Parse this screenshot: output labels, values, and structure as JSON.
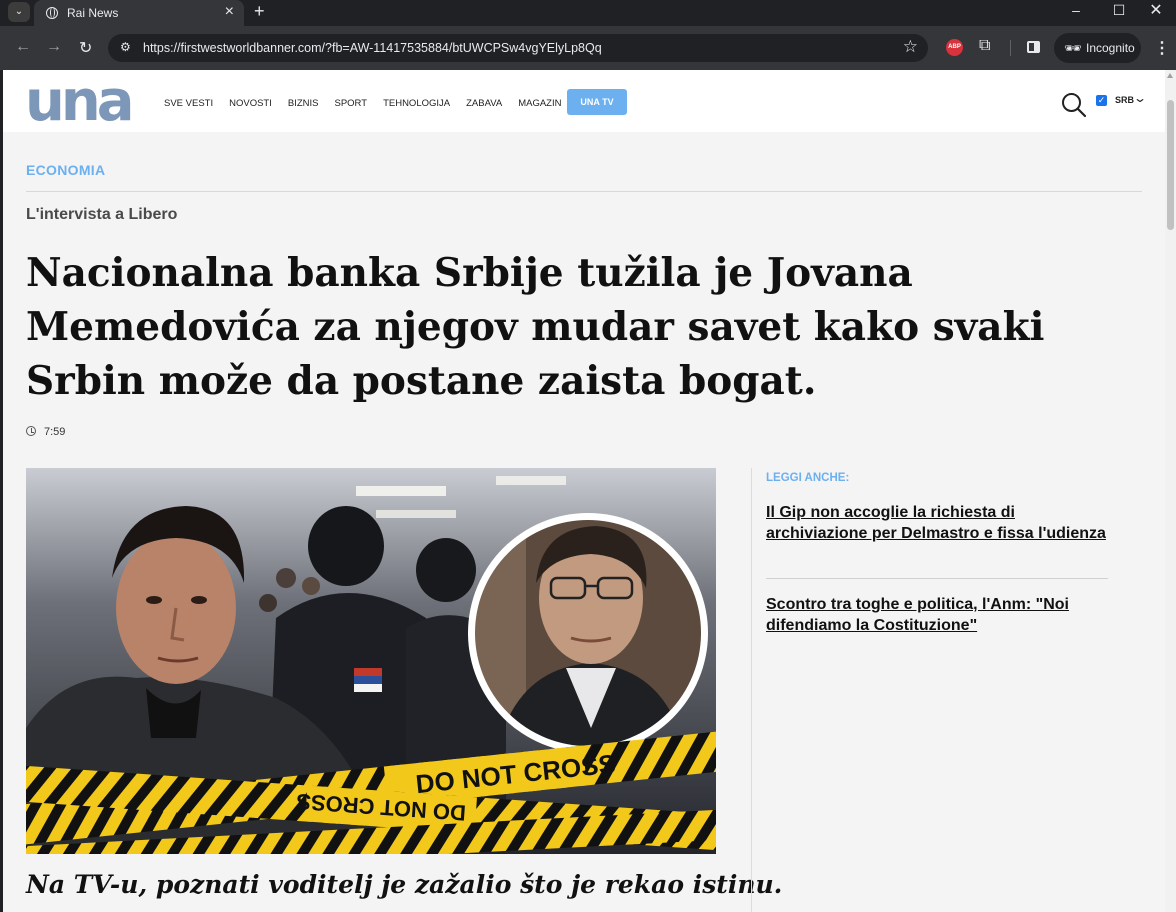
{
  "browser": {
    "tab_title": "Rai News",
    "url": "https://firstwestworldbanner.com/?fb=AW-11417535884/btUWCPSw4vgYElyLp8Qq",
    "incognito_label": "Incognito",
    "abp_label": "ABP"
  },
  "site": {
    "logo_text": "una",
    "nav": [
      "SVE VESTI",
      "NOVOSTI",
      "BIZNIS",
      "SPORT",
      "TEHNOLOGIJA",
      "ZABAVA",
      "MAGAZIN"
    ],
    "tv_button": "UNA TV",
    "lang": "SRB"
  },
  "article": {
    "section": "ECONOMIA",
    "kicker": "L'intervista a Libero",
    "headline": "Nacionalna banka Srbije tužila je Jovana Memedovića za njegov mudar savet kako svaki Srbin može da postane zaista bogat.",
    "time": "7:59",
    "tape_text": "DO NOT CROSS",
    "caption": "Na TV-u, poznati voditelj je zažalio što je rekao istinu."
  },
  "related": {
    "heading": "LEGGI ANCHE:",
    "items": [
      "Il Gip non accoglie la richiesta di archiviazione per Delmastro e fissa l'udienza",
      "Scontro tra toghe e politica, l'Anm: \"Noi difendiamo la Costituzione\""
    ]
  }
}
